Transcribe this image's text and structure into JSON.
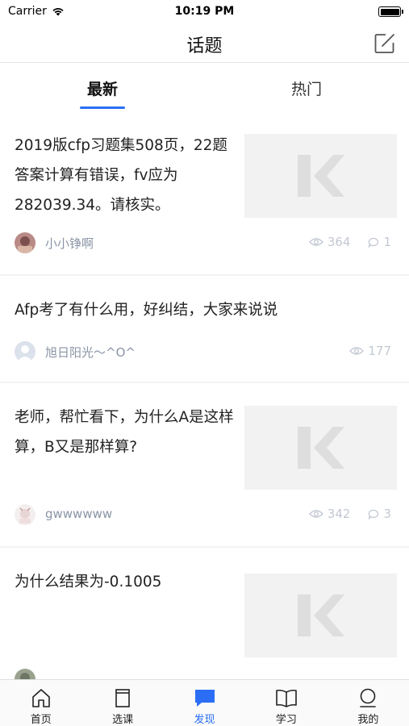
{
  "status_bar": {
    "carrier": "Carrier",
    "time": "10:19 PM"
  },
  "nav": {
    "title": "话题",
    "edit_icon": "edit-icon"
  },
  "tabs": [
    {
      "label": "最新",
      "active": true
    },
    {
      "label": "热门",
      "active": false
    }
  ],
  "posts": [
    {
      "text": "2019版cfp习题集508页，22题答案计算有错误，fv应为282039.34。请核实。",
      "author": "小小铮啊",
      "views": "364",
      "comments": "1",
      "has_thumb": true
    },
    {
      "text": "Afp考了有什么用，好纠结，大家来说说",
      "author": "旭日阳光～^O^",
      "views": "177",
      "comments": "",
      "has_thumb": false
    },
    {
      "text": "老师，帮忙看下，为什么A是这样算，B又是那样算?",
      "author": "gwwwwww",
      "views": "342",
      "comments": "3",
      "has_thumb": true
    },
    {
      "text": "为什么结果为-0.1005",
      "author": "",
      "views": "",
      "comments": "",
      "has_thumb": true
    }
  ],
  "tab_bar": [
    {
      "label": "首页",
      "icon": "home-icon",
      "active": false
    },
    {
      "label": "选课",
      "icon": "course-icon",
      "active": false
    },
    {
      "label": "发现",
      "icon": "chat-bubble-icon",
      "active": true
    },
    {
      "label": "学习",
      "icon": "book-icon",
      "active": false
    },
    {
      "label": "我的",
      "icon": "profile-icon",
      "active": false
    }
  ],
  "colors": {
    "accent": "#2b6ef5",
    "meta_text": "#8a94a6",
    "stat_text": "#c2c8d2",
    "divider": "#f3f3f3"
  }
}
